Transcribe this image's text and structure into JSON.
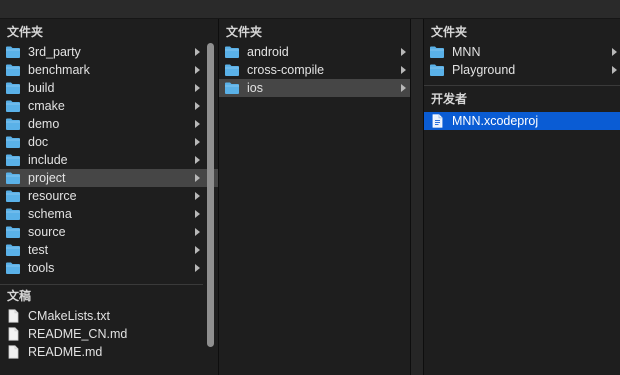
{
  "column1": {
    "folders_header": "文件夹",
    "folders": [
      {
        "name": "3rd_party"
      },
      {
        "name": "benchmark"
      },
      {
        "name": "build"
      },
      {
        "name": "cmake"
      },
      {
        "name": "demo"
      },
      {
        "name": "doc"
      },
      {
        "name": "include"
      },
      {
        "name": "project",
        "selected": true
      },
      {
        "name": "resource"
      },
      {
        "name": "schema"
      },
      {
        "name": "source"
      },
      {
        "name": "test"
      },
      {
        "name": "tools"
      }
    ],
    "documents_header": "文稿",
    "documents": [
      {
        "name": "CMakeLists.txt"
      },
      {
        "name": "README_CN.md"
      },
      {
        "name": "README.md"
      }
    ]
  },
  "column2": {
    "folders_header": "文件夹",
    "folders": [
      {
        "name": "android"
      },
      {
        "name": "cross-compile"
      },
      {
        "name": "ios",
        "selected": true
      }
    ]
  },
  "column3": {
    "folders_header": "文件夹",
    "folders": [
      {
        "name": "MNN"
      },
      {
        "name": "Playground"
      }
    ],
    "developer_header": "开发者",
    "developer_items": [
      {
        "name": "MNN.xcodeproj",
        "selected": true
      }
    ]
  },
  "colors": {
    "folder_icon": "#5ab1e8",
    "selection_blue": "#0a5cd4",
    "selection_gray": "#464646"
  },
  "icons": {
    "folder": "folder-icon",
    "document": "document-icon",
    "chevron": "chevron-right-icon"
  }
}
